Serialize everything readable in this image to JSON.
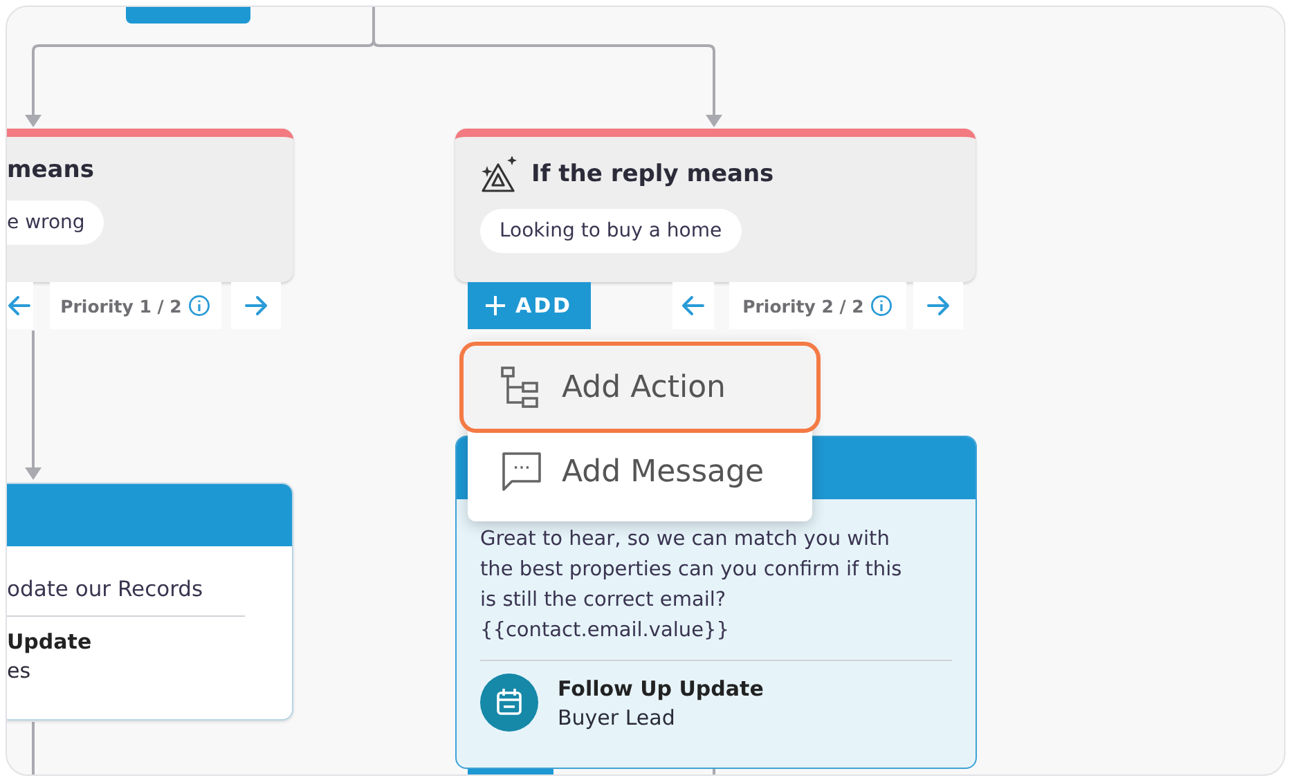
{
  "branches": [
    {
      "condition": {
        "title": "means",
        "phrase": "e wrong"
      },
      "priority": "Priority 1 / 2",
      "message": {
        "text": "odate our Records",
        "action": {
          "title": "Update",
          "subtitle": "es"
        }
      }
    },
    {
      "condition": {
        "title": "If the reply means",
        "phrase": "Looking to buy a home"
      },
      "add_button": "ADD",
      "priority": "Priority 2 / 2",
      "message": {
        "text": "Great to hear, so we can match you with the best properties can you confirm if this is still the correct email?\n{{contact.email.value}}",
        "action": {
          "title": "Follow Up Update",
          "subtitle": "Buyer Lead"
        }
      }
    }
  ],
  "add_menu": {
    "items": [
      {
        "label": "Add Action",
        "kind": "action",
        "selected": true
      },
      {
        "label": "Add Message",
        "kind": "message",
        "selected": false
      }
    ]
  }
}
